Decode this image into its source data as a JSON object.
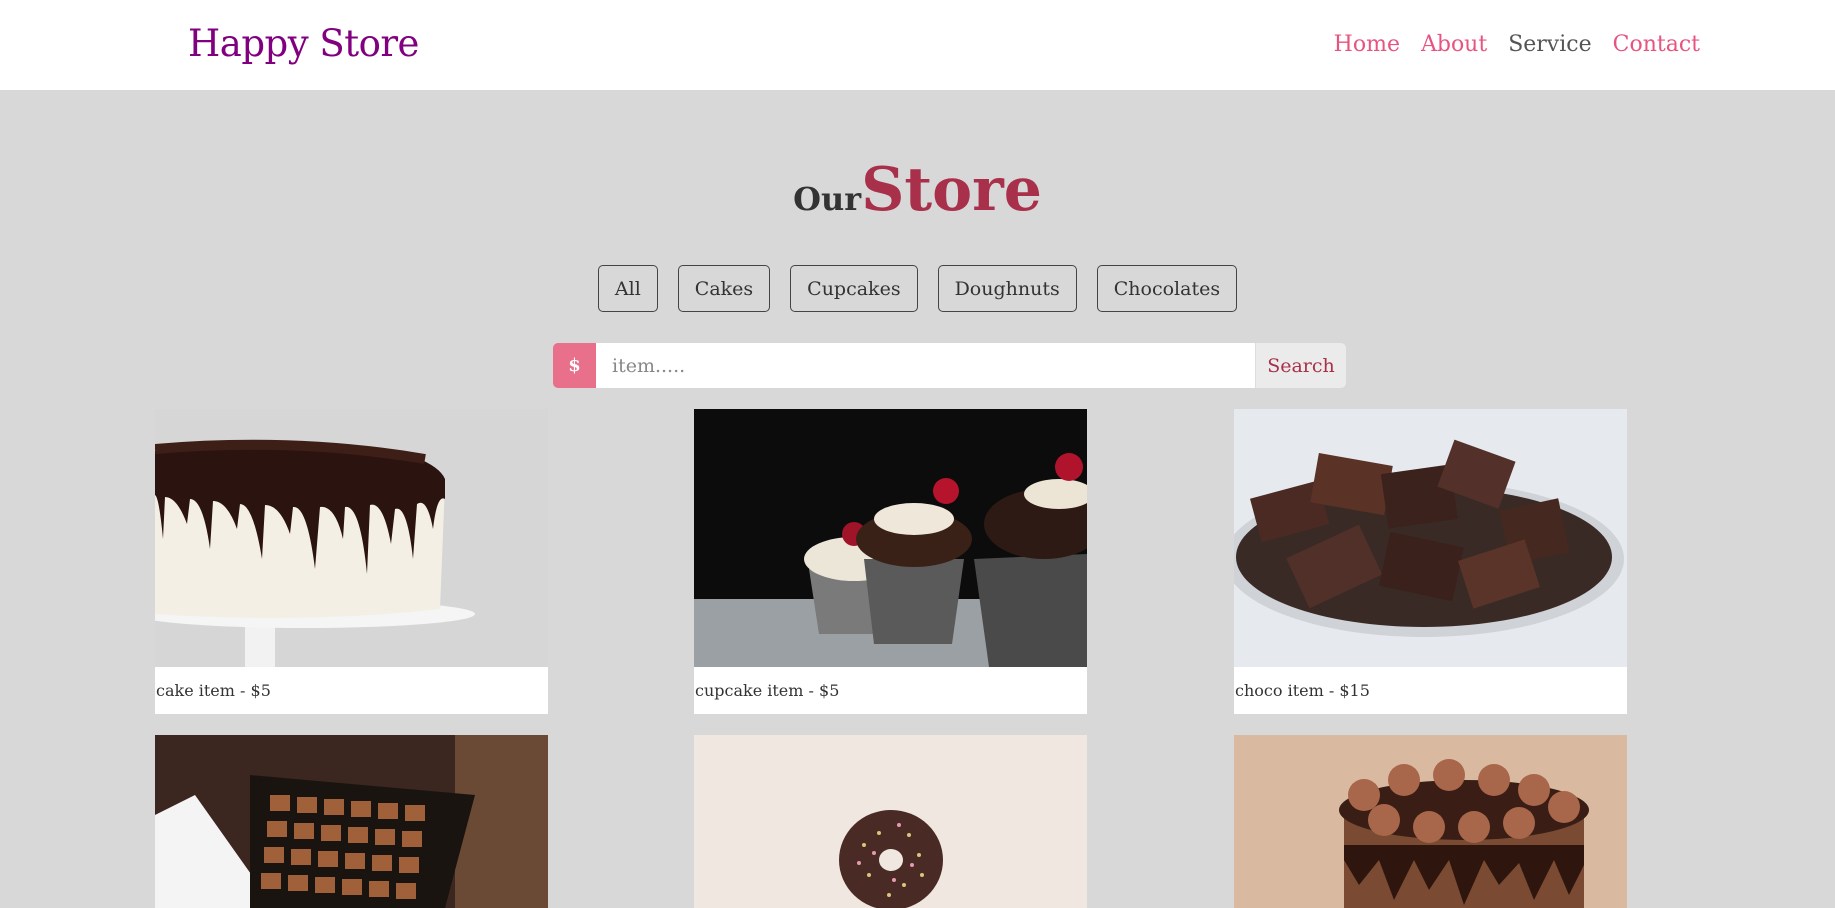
{
  "nav": {
    "brand": "Happy Store",
    "links": [
      "Home",
      "About",
      "Service",
      "Contact"
    ]
  },
  "title": {
    "prefix": "Our",
    "main": "Store"
  },
  "filters": [
    "All",
    "Cakes",
    "Cupcakes",
    "Doughnuts",
    "Chocolates"
  ],
  "search": {
    "prefix_symbol": "$",
    "placeholder": "item.....",
    "button_label": "Search"
  },
  "products": [
    {
      "caption": "cake item - $5",
      "image": "white-cake-chocolate-drip"
    },
    {
      "caption": "cupcake item - $5",
      "image": "chocolate-cupcakes-cherries"
    },
    {
      "caption": "choco item - $15",
      "image": "chocolate-pieces-plate"
    },
    {
      "caption": "",
      "image": "chocolate-box"
    },
    {
      "caption": "",
      "image": "sprinkle-doughnut"
    },
    {
      "caption": "",
      "image": "chocolate-drip-cake-frosting"
    }
  ],
  "colors": {
    "brand": "#800080",
    "nav_link": "#e75480",
    "nav_link_active": "#555555",
    "title_accent": "#a8304a",
    "search_prefix": "#e8708a",
    "background": "#d8d8d8"
  }
}
